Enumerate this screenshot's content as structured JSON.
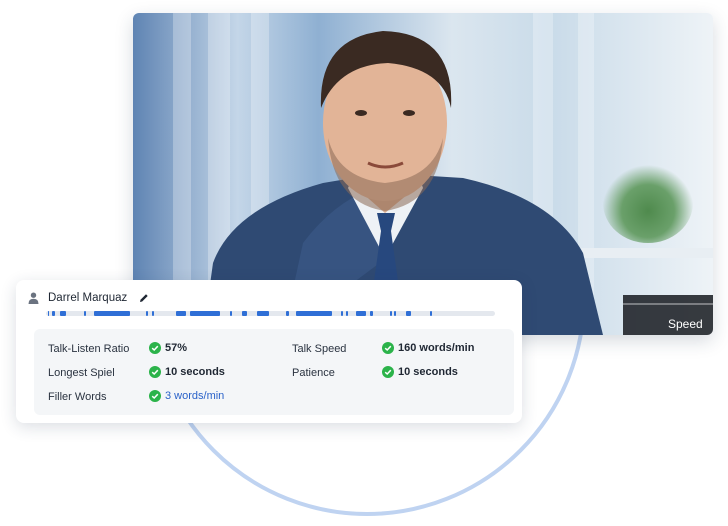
{
  "video": {
    "controls": {
      "speed_label": "Speed",
      "icons": [
        "captions-icon",
        "picture-in-picture-icon",
        "settings-icon",
        "fullscreen-icon"
      ]
    }
  },
  "card": {
    "speaker_name": "Darrel Marquaz",
    "stats": [
      {
        "label": "Talk-Listen Ratio",
        "value": "57%"
      },
      {
        "label": "Talk Speed",
        "value": "160 words/min"
      },
      {
        "label": "Longest Spiel",
        "value": "10 seconds"
      },
      {
        "label": "Patience",
        "value": "10 seconds"
      },
      {
        "label": "Filler Words",
        "value": "3 words/min"
      }
    ]
  },
  "colors": {
    "accent": "#2f6fd6",
    "check": "#2bb34a",
    "link": "#2a62c9",
    "circle": "#bfd3f1"
  }
}
